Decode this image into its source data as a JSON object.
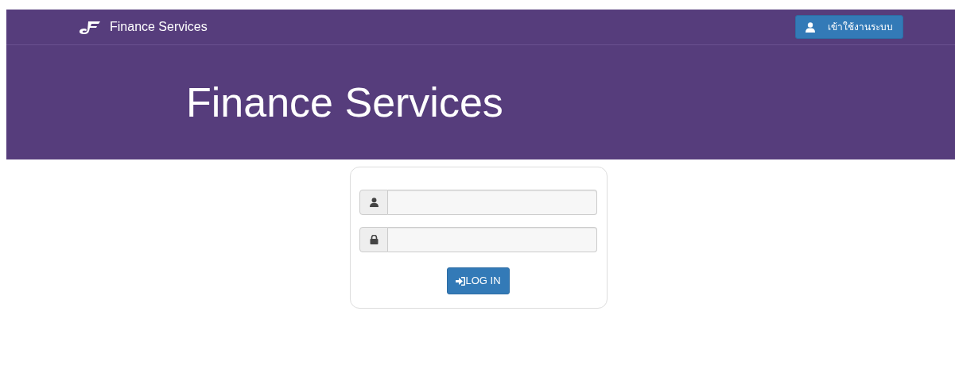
{
  "navbar": {
    "brand": "Finance Services",
    "login_button": "เข้าใช้งานระบบ"
  },
  "hero": {
    "title": "Finance Services"
  },
  "login_form": {
    "fields": [
      {
        "kind": "username"
      },
      {
        "kind": "password"
      }
    ],
    "submit_button": "LOG IN"
  }
}
